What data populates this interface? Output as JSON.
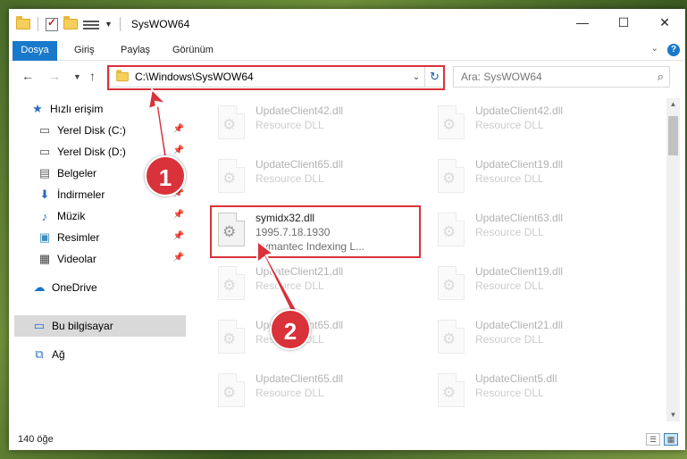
{
  "window": {
    "title": "SysWOW64"
  },
  "controls": {
    "minimize": "—",
    "maximize": "☐",
    "close": "✕"
  },
  "ribbon": {
    "tabs": [
      "Dosya",
      "Giriş",
      "Paylaş",
      "Görünüm"
    ]
  },
  "address": {
    "path": "C:\\Windows\\SysWOW64"
  },
  "search": {
    "placeholder": "Ara: SysWOW64"
  },
  "sidebar": {
    "items": [
      {
        "label": "Hızlı erişim",
        "icon": "star-icon"
      },
      {
        "label": "Yerel Disk (C:)",
        "icon": "drive-icon"
      },
      {
        "label": "Yerel Disk (D:)",
        "icon": "drive-icon"
      },
      {
        "label": "Belgeler",
        "icon": "documents-icon"
      },
      {
        "label": "İndirmeler",
        "icon": "download-icon"
      },
      {
        "label": "Müzik",
        "icon": "music-icon"
      },
      {
        "label": "Resimler",
        "icon": "pictures-icon"
      },
      {
        "label": "Videolar",
        "icon": "videos-icon"
      },
      {
        "label": "OneDrive",
        "icon": "cloud-icon"
      },
      {
        "label": "Bu bilgisayar",
        "icon": "computer-icon"
      },
      {
        "label": "Ağ",
        "icon": "network-icon"
      }
    ]
  },
  "files": {
    "left": [
      {
        "name": "UpdateClient42.dll",
        "type": "Resource DLL"
      },
      {
        "name": "UpdateClient65.dll",
        "type": "Resource DLL"
      },
      {
        "name": "symidx32.dll",
        "type": "1995.7.18.1930",
        "desc": "Symantec Indexing L..."
      },
      {
        "name": "UpdateClient21.dll",
        "type": "Resource DLL"
      },
      {
        "name": "UpdateClient65.dll",
        "type": "Resource DLL"
      },
      {
        "name": "UpdateClient65.dll",
        "type": "Resource DLL"
      }
    ],
    "right": [
      {
        "name": "UpdateClient42.dll",
        "type": "Resource DLL"
      },
      {
        "name": "UpdateClient19.dll",
        "type": "Resource DLL"
      },
      {
        "name": "UpdateClient63.dll",
        "type": "Resource DLL"
      },
      {
        "name": "UpdateClient19.dll",
        "type": "Resource DLL"
      },
      {
        "name": "UpdateClient21.dll",
        "type": "Resource DLL"
      },
      {
        "name": "UpdateClient5.dll",
        "type": "Resource DLL"
      }
    ]
  },
  "status": {
    "count": "140 öğe"
  },
  "callouts": {
    "one": "1",
    "two": "2"
  },
  "colors": {
    "accent": "#1979ca",
    "highlight": "#d9323a"
  }
}
